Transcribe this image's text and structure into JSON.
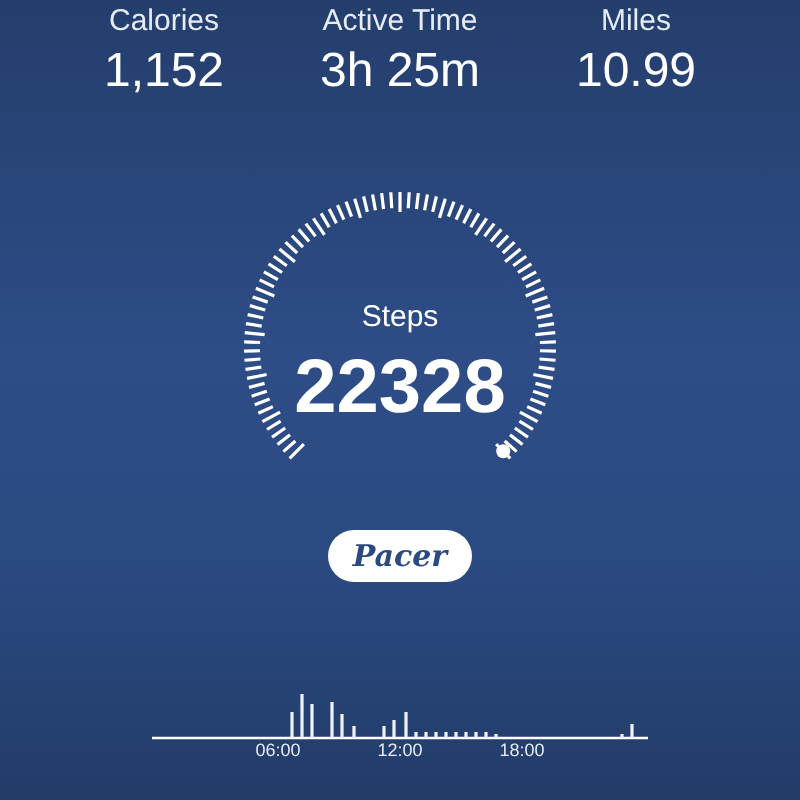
{
  "stats": [
    {
      "label": "Calories",
      "value": "1,152"
    },
    {
      "label": "Active Time",
      "value": "3h 25m"
    },
    {
      "label": "Miles",
      "value": "10.99"
    }
  ],
  "gauge": {
    "label": "Steps",
    "value": "22328"
  },
  "brand": {
    "text": "Pacer"
  },
  "hourly_chart": {
    "labels": [
      "06:00",
      "12:00",
      "18:00"
    ]
  }
}
